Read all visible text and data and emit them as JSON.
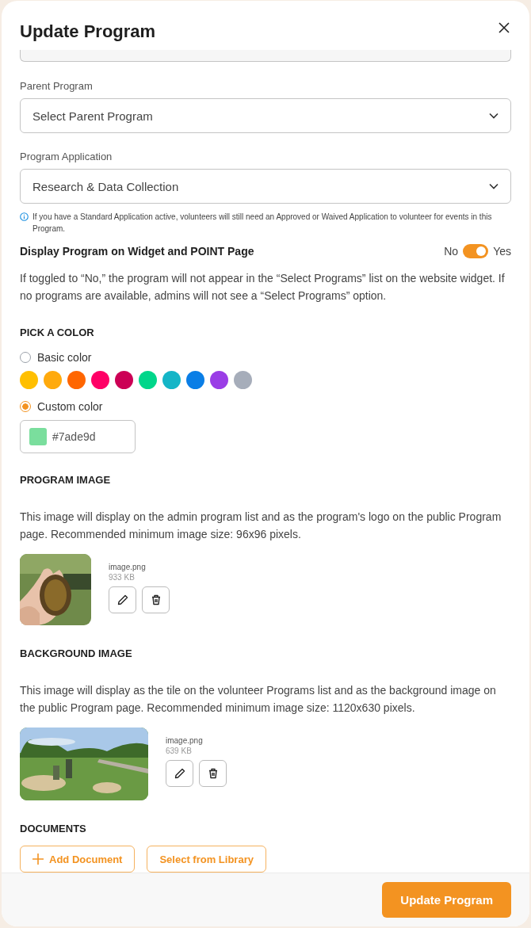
{
  "dialog": {
    "title": "Update Program"
  },
  "parent_program": {
    "label": "Parent Program",
    "value": "Select Parent Program"
  },
  "program_application": {
    "label": "Program Application",
    "value": "Research & Data Collection",
    "info": "If you have a Standard Application active, volunteers will still need an Approved or Waived Application to volunteer for events in this Program."
  },
  "display_toggle": {
    "label": "Display Program on Widget and POINT Page",
    "off_label": "No",
    "on_label": "Yes",
    "on": true,
    "description": "If toggled to “No,” the program will not appear in the “Select Programs” list on the website widget. If no programs are available, admins will not see a “Select Programs” option."
  },
  "color_section": {
    "heading": "PICK A COLOR",
    "options": [
      {
        "label": "Basic color",
        "selected": false
      },
      {
        "label": "Custom color",
        "selected": true
      }
    ],
    "swatches": [
      {
        "color": "#ffbf00",
        "selected": false
      },
      {
        "color": "#ffaa0d",
        "selected": false
      },
      {
        "color": "#ff6600",
        "selected": false
      },
      {
        "color": "#ff0066",
        "selected": false
      },
      {
        "color": "#cc0055",
        "selected": false
      },
      {
        "color": "#00d68a",
        "selected": false
      },
      {
        "color": "#14b5c7",
        "selected": false
      },
      {
        "color": "#0a7ee6",
        "selected": false
      },
      {
        "color": "#9a3de6",
        "selected": false
      },
      {
        "color": "#a6adba",
        "selected": false
      }
    ],
    "custom": {
      "color": "#7ade9d",
      "value": "#7ade9d"
    }
  },
  "program_image": {
    "heading": "PROGRAM IMAGE",
    "description": "This image will display on the admin program list and as the program's logo on the public Program page. Recommended minimum image size: 96x96 pixels.",
    "file_name": "image.png",
    "file_size": "933 KB"
  },
  "background_image": {
    "heading": "BACKGROUND IMAGE",
    "description": "This image will display as the tile on the volunteer Programs list and as the background image on the public Program page. Recommended minimum image size: 1120x630 pixels.",
    "file_name": "image.png",
    "file_size": "639 KB"
  },
  "documents": {
    "heading": "DOCUMENTS",
    "buttons": [
      "Add Document",
      "Select from Library"
    ]
  },
  "footer": {
    "button": "Update Program"
  }
}
